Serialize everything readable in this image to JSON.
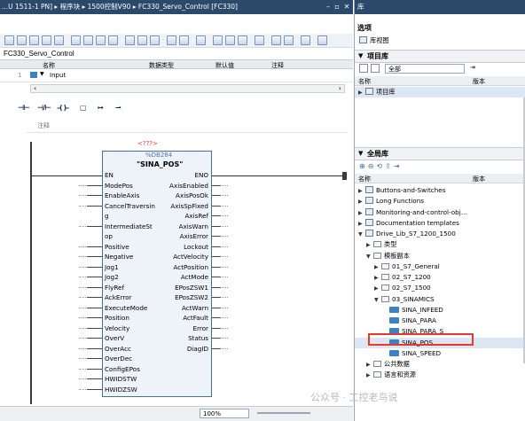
{
  "editor": {
    "title": "...U 1511-1 PN] ▸ 程序块 ▸ 1500控制V90 ▸ FC330_Servo_Control [FC330]",
    "block_name": "FC330_Servo_Control",
    "interface_columns": [
      "名称",
      "数据类型",
      "默认值",
      "注释"
    ],
    "interface_row": "Input",
    "interface_row_index": "1",
    "comment_label": "注释",
    "zoom": "100%"
  },
  "function_block": {
    "question_marks": "<???>",
    "db_name": "%DB284",
    "name": "\"SINA_POS\"",
    "inputs": [
      "EN",
      "ModePos",
      "EnableAxis",
      "CancelTraversin",
      "g",
      "IntermediateSt",
      "op",
      "Positive",
      "Negative",
      "Jog1",
      "Jog2",
      "FlyRef",
      "AckError",
      "ExecuteMode",
      "Position",
      "Velocity",
      "OverV",
      "OverAcc",
      "OverDec",
      "ConfigEPos",
      "HWIDSTW",
      "HWIDZSW"
    ],
    "outputs": [
      "ENO",
      "AxisEnabled",
      "AxisPosOk",
      "AxisSpFixed",
      "AxisRef",
      "AxisWarn",
      "AxisError",
      "Lockout",
      "ActVelocity",
      "ActPosition",
      "ActMode",
      "EPosZSW1",
      "EPosZSW2",
      "ActWarn",
      "ActFault",
      "Error",
      "Status",
      "DiagID"
    ]
  },
  "library": {
    "header": "库",
    "options_title": "选项",
    "library_view": "库视图",
    "project_library_title": "项目库",
    "filter_value": "全部",
    "col_name": "名称",
    "col_version": "版本",
    "project_library_item": "项目库",
    "global_library_title": "全局库",
    "items": {
      "i0": "Buttons-and-Switches",
      "i1": "Long Functions",
      "i2": "Monitoring-and-control-obj...",
      "i3": "Documentation templates",
      "i4": "Drive_Lib_S7_1200_1500",
      "i5": "类型",
      "i6": "模板副本",
      "i7": "01_S7_General",
      "i8": "02_S7_1200",
      "i9": "02_S7_1500",
      "i10": "03_SINAMICS",
      "i11": "SINA_INFEED",
      "i12": "SINA_PARA",
      "i13": "SINA_PARA_S",
      "i14": "SINA_POS",
      "i15": "SINA_SPEED",
      "i16": "公共数据",
      "i17": "语言和资源"
    }
  },
  "watermark": "公众号 · 工控老鸟说"
}
